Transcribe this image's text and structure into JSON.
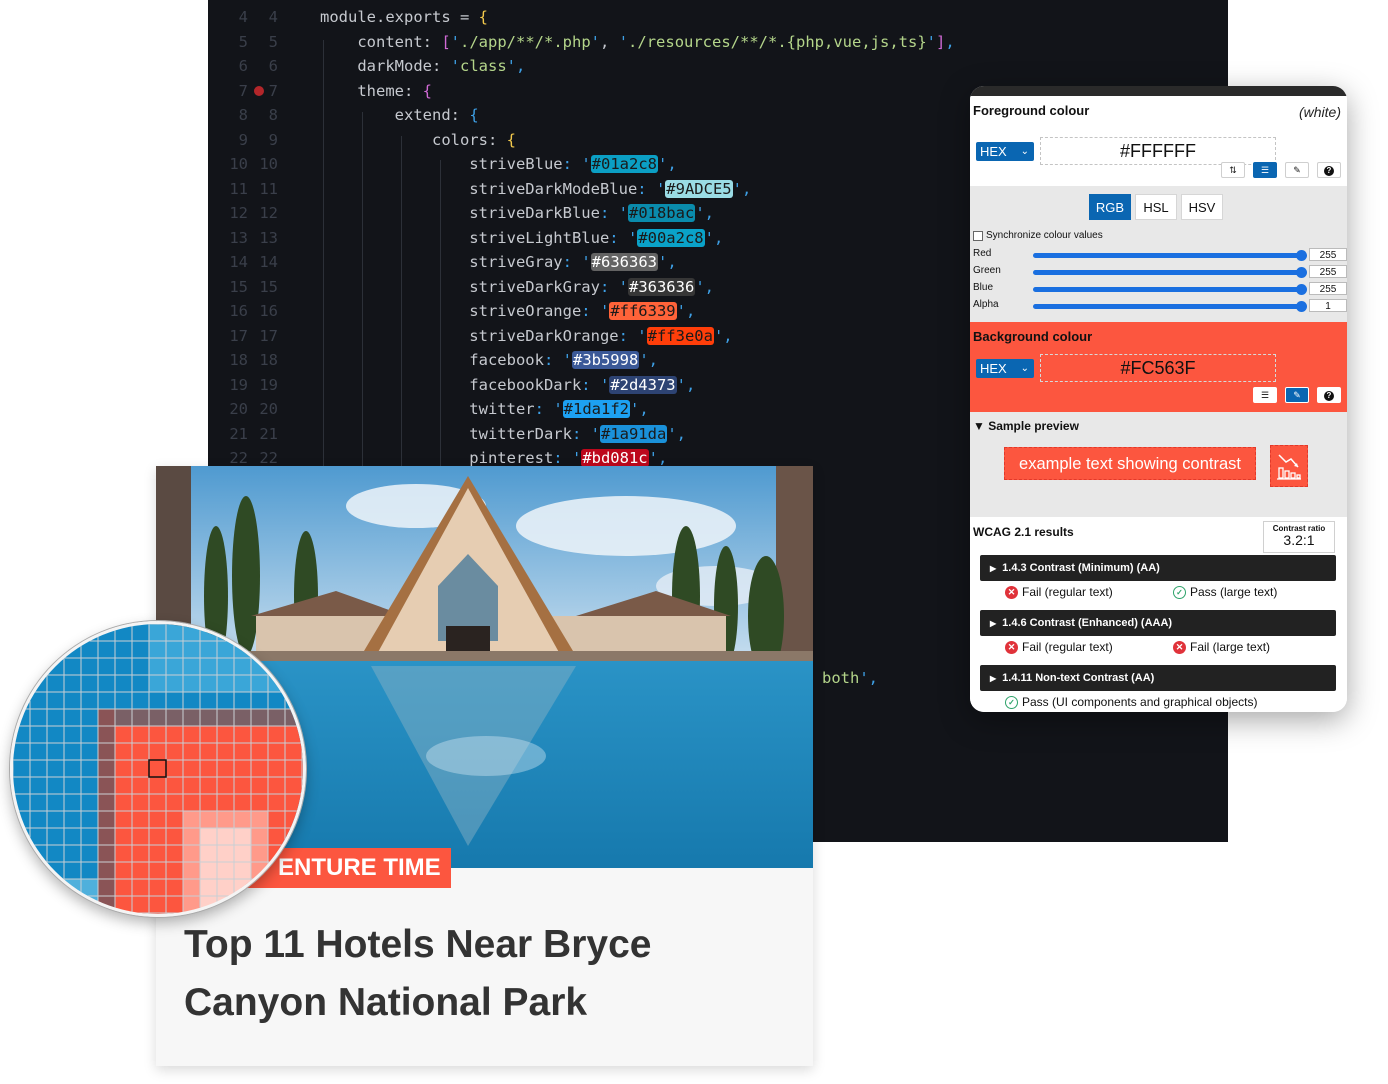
{
  "editor": {
    "breakpoint_line": 7,
    "lines": [
      {
        "n": 4,
        "segments": [
          {
            "t": "module.exports = ",
            "c": ""
          },
          {
            "t": "{",
            "c": "punc-y"
          }
        ]
      },
      {
        "n": 5,
        "segments": [
          {
            "t": "    content: ",
            "c": ""
          },
          {
            "t": "[",
            "c": "punc-p"
          },
          {
            "t": "'",
            "c": "q"
          },
          {
            "t": "./app/**/*.php",
            "c": "str"
          },
          {
            "t": "'",
            "c": "q"
          },
          {
            "t": ", ",
            "c": ""
          },
          {
            "t": "'",
            "c": "q"
          },
          {
            "t": "./resources/**/*.{php,vue,js,ts}",
            "c": "str"
          },
          {
            "t": "'",
            "c": "q"
          },
          {
            "t": "]",
            "c": "punc-p"
          },
          {
            "t": ",",
            "c": "q"
          }
        ]
      },
      {
        "n": 6,
        "segments": [
          {
            "t": "    darkMode: ",
            "c": ""
          },
          {
            "t": "'",
            "c": "q"
          },
          {
            "t": "class",
            "c": "str"
          },
          {
            "t": "'",
            "c": "q"
          },
          {
            "t": ",",
            "c": "q"
          }
        ]
      },
      {
        "n": 7,
        "segments": [
          {
            "t": "    theme: ",
            "c": ""
          },
          {
            "t": "{",
            "c": "punc-p"
          }
        ]
      },
      {
        "n": 8,
        "segments": [
          {
            "t": "        extend: ",
            "c": ""
          },
          {
            "t": "{",
            "c": "punc-b"
          }
        ]
      },
      {
        "n": 9,
        "segments": [
          {
            "t": "            colors: ",
            "c": ""
          },
          {
            "t": "{",
            "c": "punc-y"
          }
        ]
      },
      {
        "n": 10,
        "key": "striveBlue",
        "swatch": "#01a2c8",
        "bg": "#0b9fc4",
        "fg": "dark"
      },
      {
        "n": 11,
        "key": "striveDarkModeBlue",
        "swatch": "#9ADCE5",
        "bg": "#9adce5",
        "fg": "dark"
      },
      {
        "n": 12,
        "key": "striveDarkBlue",
        "swatch": "#018bac",
        "bg": "#0a8bac",
        "fg": "dark"
      },
      {
        "n": 13,
        "key": "striveLightBlue",
        "swatch": "#00a2c8",
        "bg": "#0aa2c8",
        "fg": "dark"
      },
      {
        "n": 14,
        "key": "striveGray",
        "swatch": "#636363",
        "bg": "#636363",
        "fg": "light"
      },
      {
        "n": 15,
        "key": "striveDarkGray",
        "swatch": "#363636",
        "bg": "#363636",
        "fg": "light"
      },
      {
        "n": 16,
        "key": "striveOrange",
        "swatch": "#ff6339",
        "bg": "#ff6339",
        "fg": "dark"
      },
      {
        "n": 17,
        "key": "striveDarkOrange",
        "swatch": "#ff3e0a",
        "bg": "#ff3e0a",
        "fg": "dark"
      },
      {
        "n": 18,
        "key": "facebook",
        "swatch": "#3b5998",
        "bg": "#3b5998",
        "fg": "light"
      },
      {
        "n": 19,
        "key": "facebookDark",
        "swatch": "#2d4373",
        "bg": "#2d4373",
        "fg": "light"
      },
      {
        "n": 20,
        "key": "twitter",
        "swatch": "#1da1f2",
        "bg": "#1da1f2",
        "fg": "dark"
      },
      {
        "n": 21,
        "key": "twitterDark",
        "swatch": "#1a91da",
        "bg": "#1a91da",
        "fg": "dark"
      },
      {
        "n": 22,
        "key": "pinterest",
        "swatch": "#bd081c",
        "bg": "#bd081c",
        "fg": "light"
      }
    ],
    "fragment_text": "both",
    "fragment_suffix": "',"
  },
  "analyser": {
    "foreground": {
      "title": "Foreground colour",
      "name": "(white)",
      "format": "HEX",
      "value": "#FFFFFF",
      "tools": [
        {
          "name": "swap-colours-icon",
          "glyph": "⇅",
          "active": false
        },
        {
          "name": "sliders-icon",
          "glyph": "☰",
          "active": true
        },
        {
          "name": "eyedropper-icon",
          "glyph": "✎",
          "active": false
        },
        {
          "name": "help-icon",
          "glyph": "?",
          "active": false
        }
      ]
    },
    "mode_tabs": [
      {
        "label": "RGB",
        "active": true
      },
      {
        "label": "HSL",
        "active": false
      },
      {
        "label": "HSV",
        "active": false
      }
    ],
    "sync_label": "Synchronize colour values",
    "sliders": [
      {
        "label": "Red",
        "value": "255",
        "fraction": 1
      },
      {
        "label": "Green",
        "value": "255",
        "fraction": 1
      },
      {
        "label": "Blue",
        "value": "255",
        "fraction": 1
      },
      {
        "label": "Alpha",
        "value": "1",
        "fraction": 1
      }
    ],
    "background": {
      "title": "Background colour",
      "format": "HEX",
      "value": "#FC563F",
      "color": "#fc563f"
    },
    "preview": {
      "title": "▼ Sample preview",
      "text": "example text showing contrast"
    },
    "wcag": {
      "title": "WCAG 2.1 results",
      "ratio_label": "Contrast ratio",
      "ratio_value": "3.2:1",
      "criteria": [
        {
          "label": "1.4.3 Contrast (Minimum) (AA)",
          "results": [
            {
              "status": "fail",
              "text": "Fail (regular text)"
            },
            {
              "status": "pass",
              "text": "Pass (large text)"
            }
          ]
        },
        {
          "label": "1.4.6 Contrast (Enhanced) (AAA)",
          "results": [
            {
              "status": "fail",
              "text": "Fail (regular text)"
            },
            {
              "status": "fail",
              "text": "Fail (large text)"
            }
          ]
        },
        {
          "label": "1.4.11 Non-text Contrast (AA)",
          "results": [
            {
              "status": "pass",
              "text": "Pass (UI components and graphical objects)"
            }
          ]
        }
      ]
    }
  },
  "card": {
    "tag": "ENTURE TIME",
    "title_line1": "Top 11 Hotels Near Bryce",
    "title_line2": "Canyon National Park",
    "accent": "#fc563f"
  }
}
